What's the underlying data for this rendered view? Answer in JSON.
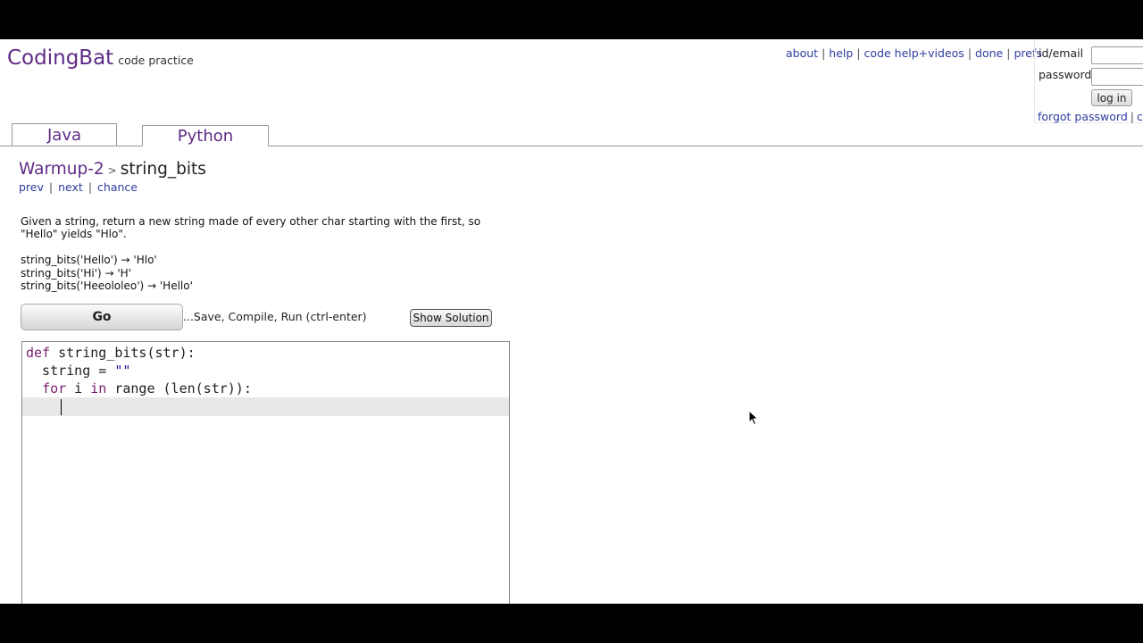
{
  "brand": {
    "name": "CodingBat",
    "tagline": "code practice"
  },
  "topnav": {
    "items": [
      "about",
      "help",
      "code help+videos",
      "done",
      "prefs"
    ]
  },
  "login": {
    "id_label": "id/email",
    "password_label": "password",
    "login_button": "log in",
    "forgot_link": "forgot password",
    "create_link": "cr"
  },
  "tabs": [
    {
      "label": "Java",
      "active": false
    },
    {
      "label": "Python",
      "active": true
    }
  ],
  "breadcrumb": {
    "section": "Warmup-2",
    "separator": ">",
    "problem": "string_bits"
  },
  "problem_nav": {
    "prev": "prev",
    "next": "next",
    "chance": "chance"
  },
  "problem": {
    "description_line1": "Given a string, return a new string made of every other char starting with the first, so",
    "description_line2": "\"Hello\" yields \"Hlo\".",
    "examples": [
      "string_bits('Hello') → 'Hlo'",
      "string_bits('Hi') → 'H'",
      "string_bits('Heeololeo') → 'Hello'"
    ]
  },
  "actions": {
    "go_label": "Go",
    "go_note": "...Save, Compile, Run (ctrl-enter)",
    "solution_label": "Show Solution"
  },
  "editor": {
    "line1_kw": "def",
    "line1_rest": " string_bits(str):",
    "line2_rest": "  string = ",
    "line2_str": "\"\"",
    "line3_kw1": "for",
    "line3_mid": " i ",
    "line3_kw2": "in",
    "line3_rest": " range (len(str)):"
  },
  "colors": {
    "brand": "#5f2b87",
    "link": "#2f3d9e",
    "keyword": "#7a1f6e"
  }
}
